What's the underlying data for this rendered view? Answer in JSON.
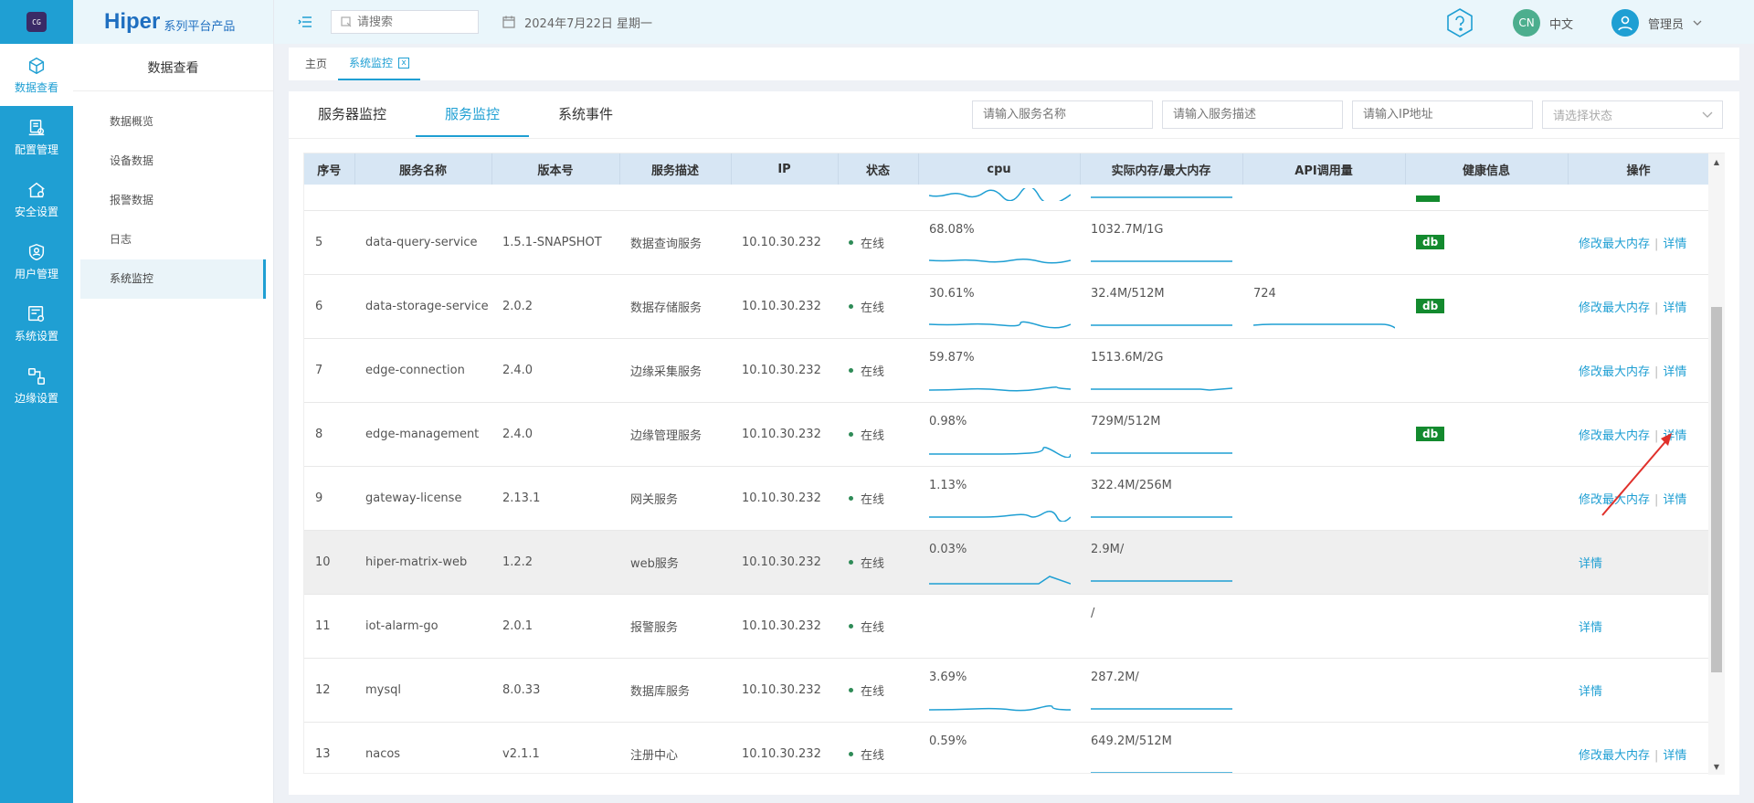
{
  "rail": {
    "logo_text": "CG",
    "items": [
      {
        "label": "数据查看",
        "icon": "data-view-icon",
        "active": true
      },
      {
        "label": "配置管理",
        "icon": "config-icon"
      },
      {
        "label": "安全设置",
        "icon": "security-icon"
      },
      {
        "label": "用户管理",
        "icon": "user-shield-icon"
      },
      {
        "label": "系统设置",
        "icon": "system-settings-icon"
      },
      {
        "label": "边缘设置",
        "icon": "edge-settings-icon"
      }
    ]
  },
  "brand": {
    "name": "Hiper",
    "suffix": "系列平台产品"
  },
  "submenu": {
    "title": "数据查看",
    "items": [
      "数据概览",
      "设备数据",
      "报警数据",
      "日志",
      "系统监控"
    ]
  },
  "header": {
    "search_placeholder": "请搜索",
    "date": "2024年7月22日 星期一",
    "lang_badge": "CN",
    "lang_label": "中文",
    "user_name": "管理员"
  },
  "tabs": [
    {
      "label": "主页"
    },
    {
      "label": "系统监控",
      "active": true,
      "close": "x"
    }
  ],
  "content_tabs": [
    "服务器监控",
    "服务监控",
    "系统事件"
  ],
  "filters": {
    "name_placeholder": "请输入服务名称",
    "desc_placeholder": "请输入服务描述",
    "ip_placeholder": "请输入IP地址",
    "status_placeholder": "请选择状态"
  },
  "table": {
    "columns": [
      "序号",
      "服务名称",
      "版本号",
      "服务描述",
      "IP",
      "状态",
      "cpu",
      "实际内存/最大内存",
      "API调用量",
      "健康信息",
      "操作"
    ],
    "rows": [
      {
        "idx": "5",
        "name": "data-query-service",
        "version": "1.5.1-SNAPSHOT",
        "desc": "数据查询服务",
        "ip": "10.10.30.232",
        "status": "在线",
        "cpu": "68.08%",
        "mem": "1032.7M/1G",
        "api": "",
        "health": "db",
        "ops": [
          "修改最大内存",
          "详情"
        ]
      },
      {
        "idx": "6",
        "name": "data-storage-service",
        "version": "2.0.2",
        "desc": "数据存储服务",
        "ip": "10.10.30.232",
        "status": "在线",
        "cpu": "30.61%",
        "mem": "32.4M/512M",
        "api": "724",
        "health": "db",
        "ops": [
          "修改最大内存",
          "详情"
        ]
      },
      {
        "idx": "7",
        "name": "edge-connection",
        "version": "2.4.0",
        "desc": "边缘采集服务",
        "ip": "10.10.30.232",
        "status": "在线",
        "cpu": "59.87%",
        "mem": "1513.6M/2G",
        "api": "",
        "health": "",
        "ops": [
          "修改最大内存",
          "详情"
        ]
      },
      {
        "idx": "8",
        "name": "edge-management",
        "version": "2.4.0",
        "desc": "边缘管理服务",
        "ip": "10.10.30.232",
        "status": "在线",
        "cpu": "0.98%",
        "mem": "729M/512M",
        "api": "",
        "health": "db",
        "ops": [
          "修改最大内存",
          "详情"
        ]
      },
      {
        "idx": "9",
        "name": "gateway-license",
        "version": "2.13.1",
        "desc": "网关服务",
        "ip": "10.10.30.232",
        "status": "在线",
        "cpu": "1.13%",
        "mem": "322.4M/256M",
        "api": "",
        "health": "",
        "ops": [
          "修改最大内存",
          "详情"
        ]
      },
      {
        "idx": "10",
        "name": "hiper-matrix-web",
        "version": "1.2.2",
        "desc": "web服务",
        "ip": "10.10.30.232",
        "status": "在线",
        "cpu": "0.03%",
        "mem": "2.9M/",
        "api": "",
        "health": "",
        "ops": [
          "详情"
        ]
      },
      {
        "idx": "11",
        "name": "iot-alarm-go",
        "version": "2.0.1",
        "desc": "报警服务",
        "ip": "10.10.30.232",
        "status": "在线",
        "cpu": "",
        "mem": "/",
        "api": "",
        "health": "",
        "ops": [
          "详情"
        ]
      },
      {
        "idx": "12",
        "name": "mysql",
        "version": "8.0.33",
        "desc": "数据库服务",
        "ip": "10.10.30.232",
        "status": "在线",
        "cpu": "3.69%",
        "mem": "287.2M/",
        "api": "",
        "health": "",
        "ops": [
          "详情"
        ]
      },
      {
        "idx": "13",
        "name": "nacos",
        "version": "v2.1.1",
        "desc": "注册中心",
        "ip": "10.10.30.232",
        "status": "在线",
        "cpu": "0.59%",
        "mem": "649.2M/512M",
        "api": "",
        "health": "",
        "ops": [
          "修改最大内存",
          "详情"
        ]
      }
    ]
  },
  "colors": {
    "accent": "#1f9fd3",
    "health_badge": "#138a2e",
    "annotation": "#e0302b"
  }
}
